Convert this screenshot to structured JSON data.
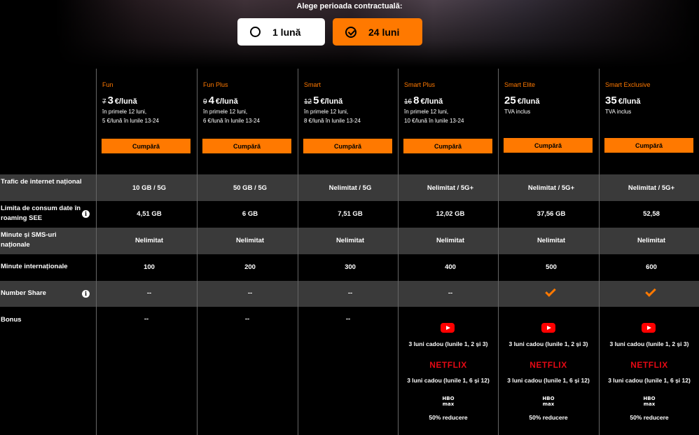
{
  "header": {
    "title": "Alege perioada contractuală:",
    "options": [
      {
        "label": "1 lună",
        "selected": false
      },
      {
        "label": "24 luni",
        "selected": true
      }
    ]
  },
  "colors": {
    "accent": "#ff7900",
    "band": "#3a3a3a",
    "netflix": "#e50914",
    "youtube": "#ff0000"
  },
  "plans": [
    {
      "name": "Fun",
      "old_price": "7",
      "price": "3",
      "unit": "€/lună",
      "note1": "în primele 12 luni,",
      "note2": "5 €/lună în lunile 13-24",
      "buy": "Cumpără"
    },
    {
      "name": "Fun Plus",
      "old_price": "9",
      "price": "4",
      "unit": "€/lună",
      "note1": "în primele 12 luni,",
      "note2": "6 €/lună în lunile 13-24",
      "buy": "Cumpără"
    },
    {
      "name": "Smart",
      "old_price": "12",
      "price": "5",
      "unit": "€/lună",
      "note1": "în primele 12 luni,",
      "note2": "8 €/lună în lunile 13-24",
      "buy": "Cumpără"
    },
    {
      "name": "Smart Plus",
      "old_price": "16",
      "price": "8",
      "unit": "€/lună",
      "note1": "în primele 12 luni,",
      "note2": "10 €/lună în lunile 13-24",
      "buy": "Cumpără"
    },
    {
      "name": "Smart Elite",
      "old_price": "",
      "price": "25",
      "unit": "€/lună",
      "note1": "TVA inclus",
      "note2": "",
      "buy": "Cumpără"
    },
    {
      "name": "Smart Exclusive",
      "old_price": "",
      "price": "35",
      "unit": "€/lună",
      "note1": "TVA inclus",
      "note2": "",
      "buy": "Cumpără"
    }
  ],
  "rows": [
    {
      "label": "Trafic de internet național",
      "values": [
        "10 GB / 5G",
        "50 GB / 5G",
        "Nelimitat / 5G",
        "Nelimitat / 5G+",
        "Nelimitat / 5G+",
        "Nelimitat / 5G+"
      ]
    },
    {
      "label": "Limita de consum date în roaming SEE",
      "values": [
        "4,51 GB",
        "6 GB",
        "7,51 GB",
        "12,02 GB",
        "37,56 GB",
        "52,58"
      ]
    },
    {
      "label": "Minute și SMS-uri naționale",
      "values": [
        "Nelimitat",
        "Nelimitat",
        "Nelimitat",
        "Nelimitat",
        "Nelimitat",
        "Nelimitat"
      ]
    },
    {
      "label": "Minute internaționale",
      "values": [
        "100",
        "200",
        "300",
        "400",
        "500",
        "600"
      ]
    },
    {
      "label": "Number Share",
      "values": [
        "--",
        "--",
        "--",
        "--",
        "check",
        "check"
      ]
    },
    {
      "label": "Bonus",
      "values": [
        "--",
        "--",
        "--",
        "",
        "",
        ""
      ]
    }
  ],
  "bonus": {
    "youtube_text": "3 luni cadou (lunile 1, 2 și 3)",
    "netflix_logo": "NETFLIX",
    "netflix_text": "3 luni cadou (lunile 1, 6 și 12)",
    "hbo_logo_line1": "HBO",
    "hbo_logo_line2": "max",
    "hbo_text": "50% reducere"
  }
}
